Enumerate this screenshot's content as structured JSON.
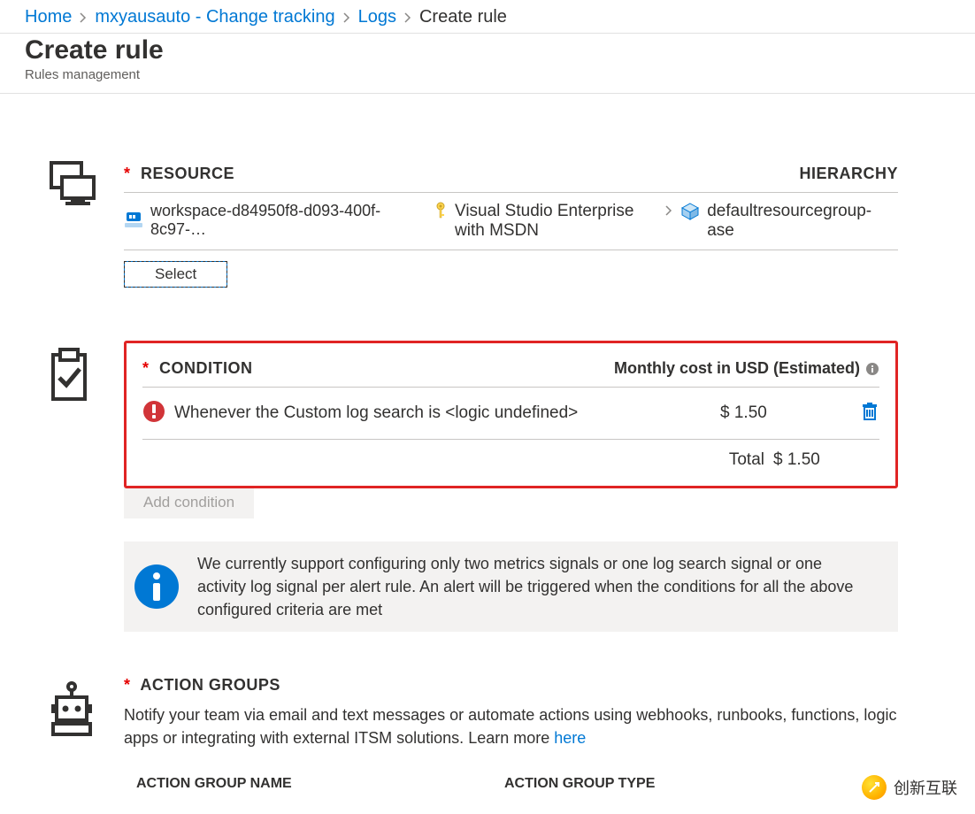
{
  "breadcrumb": {
    "home": "Home",
    "automation": "mxyausauto - Change tracking",
    "logs": "Logs",
    "current": "Create rule"
  },
  "header": {
    "title": "Create rule",
    "subtitle": "Rules management"
  },
  "resource": {
    "section_title": "RESOURCE",
    "hierarchy_title": "HIERARCHY",
    "workspace_name": "workspace-d84950f8-d093-400f-8c97-…",
    "subscription": "Visual Studio Enterprise with MSDN",
    "resource_group": "defaultresourcegroup-ase",
    "select_label": "Select"
  },
  "condition": {
    "section_title": "CONDITION",
    "cost_header": "Monthly cost in USD (Estimated)",
    "rule_text": "Whenever the Custom log search is <logic undefined>",
    "rule_cost": "$ 1.50",
    "total_label": "Total",
    "total_value": "$ 1.50",
    "add_condition_label": "Add condition",
    "info_text": "We currently support configuring only two metrics signals or one log search signal or one activity log signal per alert rule. An alert will be triggered when the conditions for all the above configured criteria are met"
  },
  "action_groups": {
    "section_title": "ACTION GROUPS",
    "description_pre": "Notify your team via email and text messages or automate actions using webhooks, runbooks, functions, logic apps or integrating with external ITSM solutions. Learn more ",
    "learn_more": "here",
    "col_name": "ACTION GROUP NAME",
    "col_type": "ACTION GROUP TYPE"
  },
  "watermark": {
    "text": "创新互联"
  }
}
